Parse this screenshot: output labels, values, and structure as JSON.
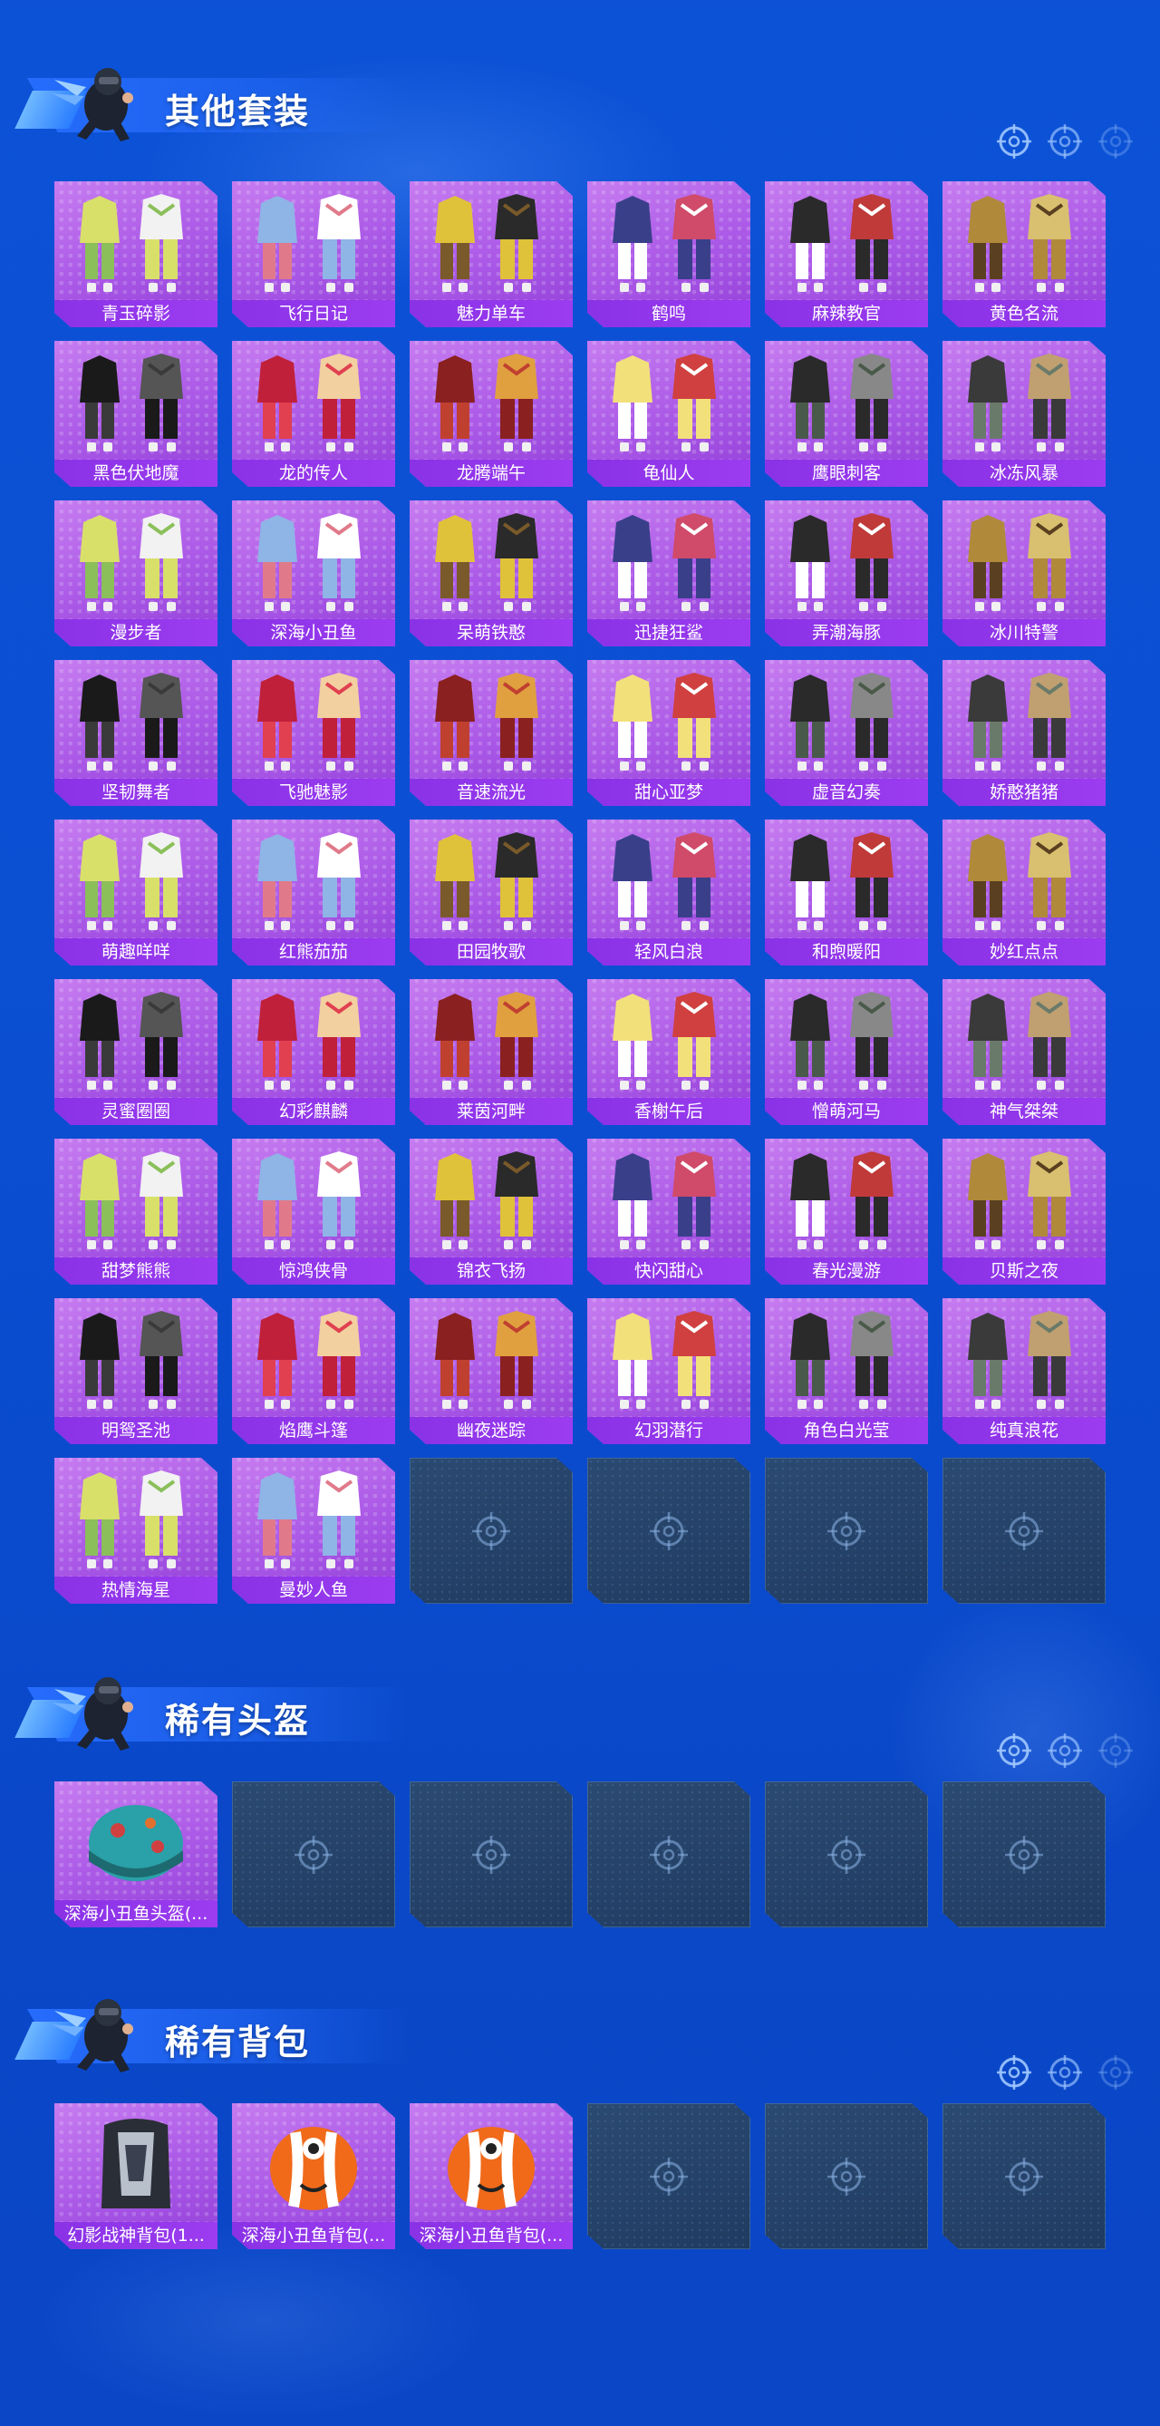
{
  "sections": [
    {
      "title": "其他套装",
      "items": [
        "青玉碎影",
        "飞行日记",
        "魅力单车",
        "鹤鸣",
        "麻辣教官",
        "黄色名流",
        "黑色伏地魔",
        "龙的传人",
        "龙腾端午",
        "龟仙人",
        "鹰眼刺客",
        "冰冻风暴",
        "漫步者",
        "深海小丑鱼",
        "呆萌铁憨",
        "迅捷狂鲨",
        "弄潮海豚",
        "冰川特警",
        "坚韧舞者",
        "飞驰魅影",
        "音速流光",
        "甜心亚梦",
        "虚音幻奏",
        "娇憨猪猪",
        "萌趣咩咩",
        "红熊茄茄",
        "田园牧歌",
        "轻风白浪",
        "和煦暖阳",
        "妙红点点",
        "灵蜜圈圈",
        "幻彩麒麟",
        "莱茵河畔",
        "香榭午后",
        "憎萌河马",
        "神气桀桀",
        "甜梦熊熊",
        "惊鸿侠骨",
        "锦衣飞扬",
        "快闪甜心",
        "春光漫游",
        "贝斯之夜",
        "明鸳圣池",
        "焰鹰斗篷",
        "幽夜迷踪",
        "幻羽潜行",
        "角色白光莹",
        "纯真浪花",
        "热情海星",
        "曼妙人鱼"
      ],
      "empty_slots": 4
    },
    {
      "title": "稀有头盔",
      "items": [
        "深海小丑鱼头盔(..."
      ],
      "empty_slots": 5
    },
    {
      "title": "稀有背包",
      "items": [
        "幻影战神背包(1...",
        "深海小丑鱼背包(...",
        "深海小丑鱼背包(..."
      ],
      "empty_slots": 3
    }
  ],
  "icons": {
    "mascot": "winged-soldier-mascot-icon",
    "section_decor": "crosshair-icon",
    "empty_slot": "crosshair-icon"
  },
  "colors": {
    "background": "#0c52d6",
    "card_filled": "#a957e6",
    "card_label": "#8a32e6",
    "card_empty": "#243f64"
  }
}
